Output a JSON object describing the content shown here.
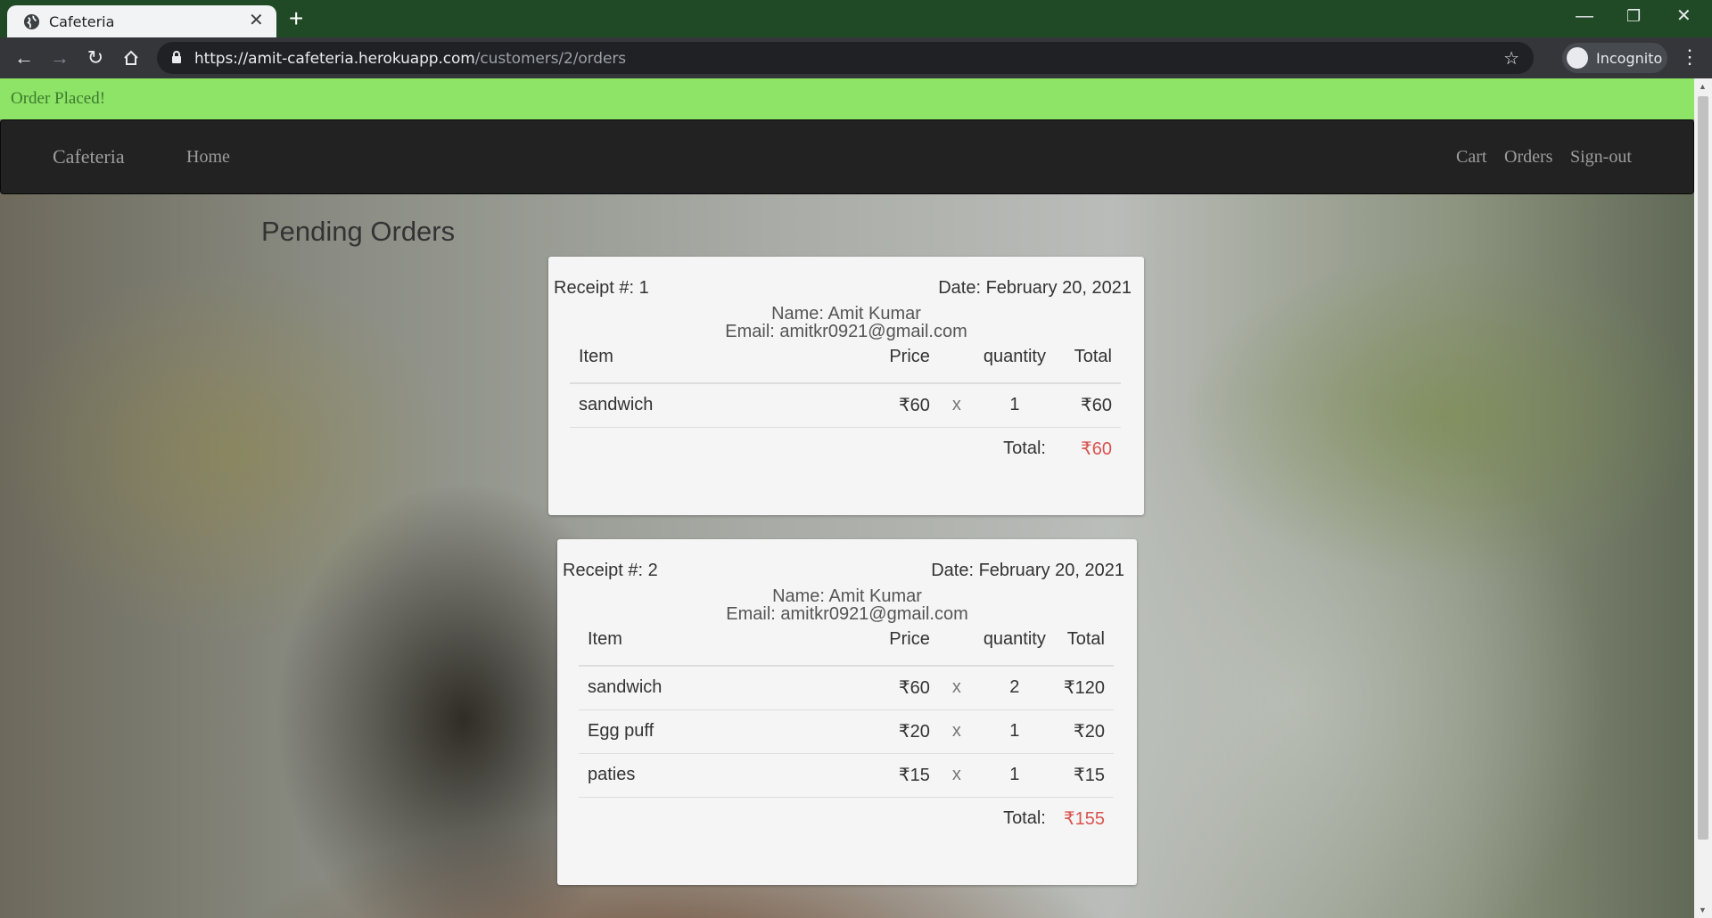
{
  "browser": {
    "tab_title": "Cafeteria",
    "url_host": "https://amit-cafeteria.herokuapp.com",
    "url_path": "/customers/2/orders",
    "incognito_label": "Incognito"
  },
  "flash": {
    "message": "Order Placed!"
  },
  "navbar": {
    "brand": "Cafeteria",
    "home": "Home",
    "cart": "Cart",
    "orders": "Orders",
    "signout": "Sign-out"
  },
  "page": {
    "heading": "Pending Orders"
  },
  "columns": {
    "item": "Item",
    "price": "Price",
    "quantity": "quantity",
    "total": "Total"
  },
  "total_label": "Total:",
  "multiply_sign": "x",
  "colors": {
    "total_value": "#d9534f",
    "flash_bg": "#8de466",
    "navbar_bg": "#222222"
  },
  "orders": [
    {
      "receipt": "Receipt #: 1",
      "date": "Date: February 20, 2021",
      "name": "Name: Amit Kumar",
      "email": "Email: amitkr0921@gmail.com",
      "items": [
        {
          "name": "sandwich",
          "price": "₹60",
          "qty": "1",
          "total": "₹60"
        }
      ],
      "grand_total": "₹60"
    },
    {
      "receipt": "Receipt #: 2",
      "date": "Date: February 20, 2021",
      "name": "Name: Amit Kumar",
      "email": "Email: amitkr0921@gmail.com",
      "items": [
        {
          "name": "sandwich",
          "price": "₹60",
          "qty": "2",
          "total": "₹120"
        },
        {
          "name": "Egg puff",
          "price": "₹20",
          "qty": "1",
          "total": "₹20"
        },
        {
          "name": "paties",
          "price": "₹15",
          "qty": "1",
          "total": "₹15"
        }
      ],
      "grand_total": "₹155"
    }
  ]
}
